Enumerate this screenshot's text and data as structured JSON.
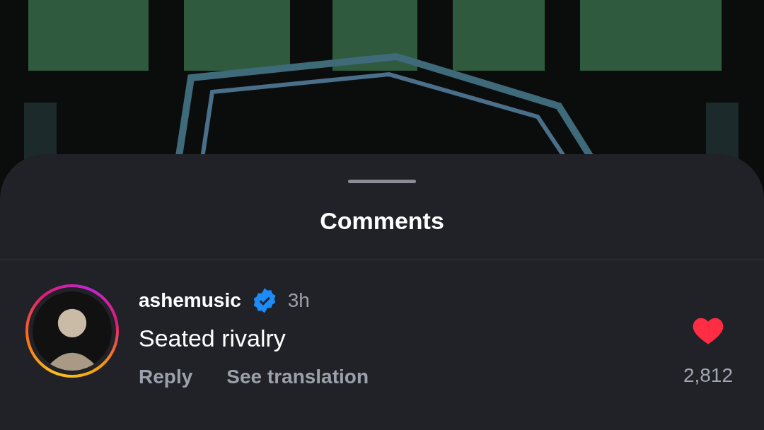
{
  "sheet": {
    "title": "Comments"
  },
  "comments": [
    {
      "username": "ashemusic",
      "verified": true,
      "time": "3h",
      "text": "Seated rivalry",
      "actions": [
        "Reply",
        "See translation"
      ],
      "liked": true,
      "like_count": "2,812"
    }
  ]
}
